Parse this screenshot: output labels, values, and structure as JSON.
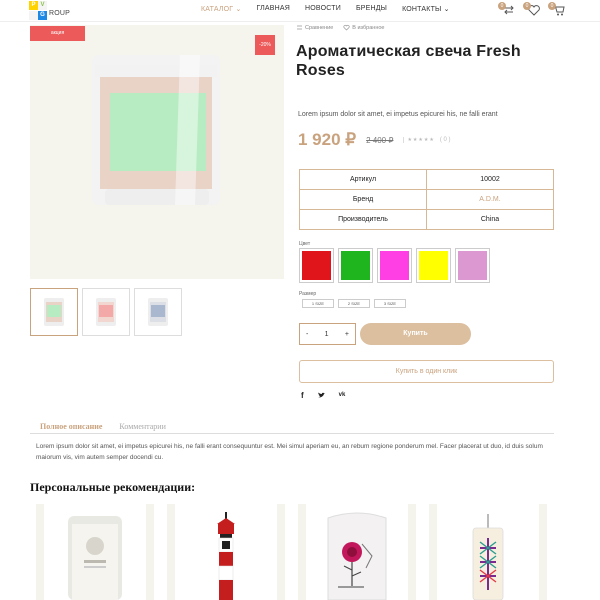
{
  "header": {
    "logo_letters": [
      "P",
      "V",
      "G"
    ],
    "logo_text": "ROUP",
    "nav": [
      {
        "label": "КАТАЛОГ ⌄",
        "active": true
      },
      {
        "label": "ГЛАВНАЯ",
        "active": false
      },
      {
        "label": "НОВОСТИ",
        "active": false
      },
      {
        "label": "БРЕНДЫ",
        "active": false
      },
      {
        "label": "КОНТАКТЫ ⌄",
        "active": false
      }
    ],
    "icons": [
      {
        "name": "compare-icon",
        "count": "0"
      },
      {
        "name": "wishlist-icon",
        "count": "0"
      },
      {
        "name": "cart-icon",
        "count": "0"
      }
    ]
  },
  "gallery": {
    "badge_new": "акция",
    "badge_sale": "-20%",
    "thumb_count": 3
  },
  "product": {
    "compare_label": "Сравнение",
    "favorite_label": "В избранное",
    "title": "Ароматическая свеча Fresh Roses",
    "short_desc": "Lorem ipsum dolor sit amet, ei impetus epicurei his, ne falli erant",
    "price": "1 920 ₽",
    "old_price": "2 400 ₽",
    "rating_stars": "★★★★★",
    "rating_count": "( 0 )",
    "specs": [
      {
        "label": "Артикул",
        "value": "10002"
      },
      {
        "label": "Бренд",
        "value": "A.D.M."
      },
      {
        "label": "Производитель",
        "value": "China"
      }
    ],
    "color_label": "Цвет",
    "colors": [
      "#e0151b",
      "#1eb51e",
      "#ff3fe3",
      "#ffff00",
      "#dc98d0"
    ],
    "size_label": "Размер",
    "sizes": [
      "1 SIZE",
      "2 SIZE",
      "3 SIZE"
    ],
    "qty_minus": "-",
    "qty_value": "1",
    "qty_plus": "+",
    "buy_label": "Купить",
    "oneclick_label": "Купить в один клик",
    "social": [
      "f",
      "t",
      "vk"
    ]
  },
  "tabs": {
    "items": [
      {
        "label": "Полное описание",
        "active": true
      },
      {
        "label": "Комментарии",
        "active": false
      }
    ],
    "full_desc": "Lorem ipsum dolor sit amet, ei impetus epicurei his, ne falli erant consequuntur est. Mei simul aperiam eu, an rebum regione ponderum mel. Facer placerat ut duo, id duis solum maiorum vis, vim autem semper docendi cu."
  },
  "recommendations": {
    "title": "Персональные рекомендации:",
    "items": [
      {
        "name": "white-candle-jar"
      },
      {
        "name": "lighthouse-candle"
      },
      {
        "name": "rose-painted-candle"
      },
      {
        "name": "pattern-glass-candle"
      }
    ]
  }
}
